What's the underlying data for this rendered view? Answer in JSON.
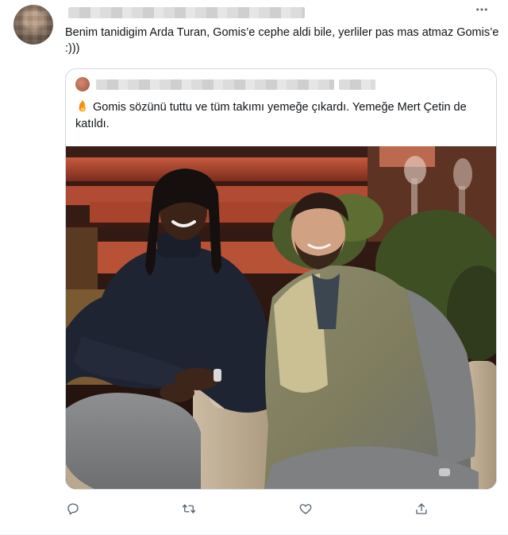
{
  "tweet": {
    "text": "Benim tanidigim Arda Turan, Gomis’e cephe aldi bile, yerliler pas mas atmaz Gomis’e :)))",
    "more_icon": "more-horizontal-icon"
  },
  "quoted_tweet": {
    "text": "Gomis sözünü tuttu ve tüm takımı yemeğe çıkardı. Yemeğe Mert Çetin de katıldı.",
    "emoji": "fire-emoji"
  },
  "actions": {
    "icons": [
      "reply-icon",
      "retweet-icon",
      "like-icon",
      "share-icon"
    ]
  },
  "colors": {
    "text": "#0f1419",
    "secondary": "#536471",
    "border": "#cfd9de"
  }
}
